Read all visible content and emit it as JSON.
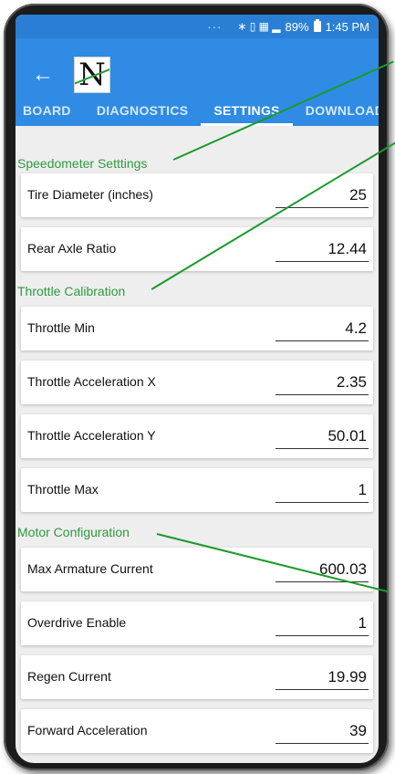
{
  "status": {
    "dots": "···",
    "icons": "∗ ▯ ▦ ▂",
    "battery": "89%",
    "time": "1:45 PM"
  },
  "appbar": {
    "back_icon": "←",
    "logo_letter": "N"
  },
  "tabs": [
    {
      "label": "BOARD"
    },
    {
      "label": "DIAGNOSTICS"
    },
    {
      "label": "SETTINGS"
    },
    {
      "label": "DOWNLOAD"
    }
  ],
  "sections": {
    "speedometer": {
      "title": "Speedometer Setttings",
      "rows": [
        {
          "label": "Tire Diameter (inches)",
          "value": "25"
        },
        {
          "label": "Rear Axle Ratio",
          "value": "12.44"
        }
      ]
    },
    "throttle": {
      "title": "Throttle Calibration",
      "rows": [
        {
          "label": "Throttle Min",
          "value": "4.2"
        },
        {
          "label": "Throttle Acceleration X",
          "value": "2.35"
        },
        {
          "label": "Throttle Acceleration Y",
          "value": "50.01"
        },
        {
          "label": "Throttle Max",
          "value": "1"
        }
      ]
    },
    "motor": {
      "title": "Motor Configuration",
      "rows": [
        {
          "label": "Max Armature Current",
          "value": "600.03"
        },
        {
          "label": "Overdrive Enable",
          "value": "1"
        },
        {
          "label": "Regen Current",
          "value": "19.99"
        },
        {
          "label": "Forward Acceleration",
          "value": "39"
        }
      ]
    }
  },
  "colors": {
    "appbar": "#2f8be3",
    "statusbar": "#2a7fd4",
    "section_title": "#2f9a3f",
    "callout_line": "#1a9a2a"
  }
}
